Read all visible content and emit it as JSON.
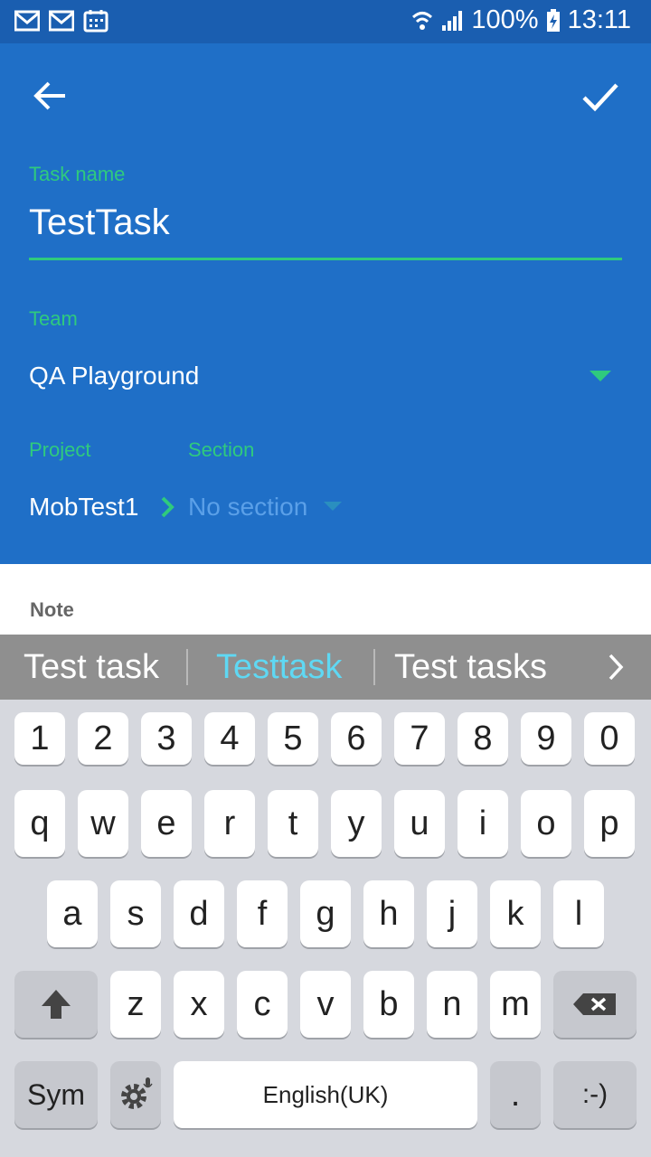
{
  "status_bar": {
    "left_icons": [
      "gmail-icon",
      "gmail-icon",
      "calendar-icon"
    ],
    "right_icons": [
      "wifi-icon",
      "signal-icon",
      "battery-charging-icon"
    ],
    "battery": "100%",
    "time": "13:11"
  },
  "header": {
    "back_icon": "arrow-left-icon",
    "confirm_icon": "check-icon"
  },
  "form": {
    "task_name_label": "Task name",
    "task_name_value": "TestTask",
    "team_label": "Team",
    "team_value": "QA Playground",
    "project_label": "Project",
    "project_value": "MobTest1",
    "section_label": "Section",
    "section_value": "No section",
    "note_label": "Note"
  },
  "suggestions": [
    "Test task",
    "Testtask",
    "Test tasks"
  ],
  "keyboard": {
    "row_numbers": [
      "1",
      "2",
      "3",
      "4",
      "5",
      "6",
      "7",
      "8",
      "9",
      "0"
    ],
    "row_q": [
      "q",
      "w",
      "e",
      "r",
      "t",
      "y",
      "u",
      "i",
      "o",
      "p"
    ],
    "row_a": [
      "a",
      "s",
      "d",
      "f",
      "g",
      "h",
      "j",
      "k",
      "l"
    ],
    "row_z": [
      "z",
      "x",
      "c",
      "v",
      "b",
      "n",
      "m"
    ],
    "sym_label": "Sym",
    "space_label": "English(UK)",
    "period_label": ".",
    "emoticon_label": ":-)"
  },
  "colors": {
    "header_bg": "#1f6fc7",
    "status_bg": "#1a5eb0",
    "accent_green": "#2fca7e",
    "suggestion_highlight": "#5fd8f3"
  }
}
